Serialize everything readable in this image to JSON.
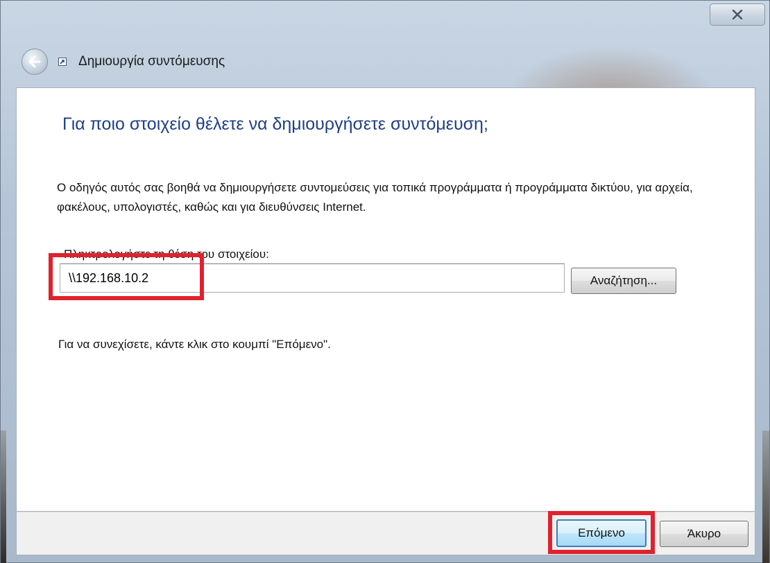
{
  "window": {
    "title": "Δημιουργία συντόμευσης",
    "close_icon": "close-icon",
    "back_icon": "back-arrow-icon",
    "title_icon": "shortcut-icon"
  },
  "content": {
    "heading": "Για ποιο στοιχείο θέλετε να δημιουργήσετε συντόμευση;",
    "description": "Ο οδηγός αυτός σας βοηθά να δημιουργήσετε συντομεύσεις για τοπικά προγράμματα ή προγράμματα δικτύου, για αρχεία, φακέλους, υπολογιστές, καθώς και για διευθύνσεις Internet.",
    "location_label": "Πληκτρολογήστε τη θέση του στοιχείου:",
    "location_value": "\\\\192.168.10.2",
    "browse_label": "Αναζήτηση...",
    "instruction": "Για να συνεχίσετε, κάντε κλικ στο κουμπί \"Επόμενο\"."
  },
  "footer": {
    "next_label": "Επόμενο",
    "cancel_label": "Άκυρο"
  },
  "colors": {
    "heading": "#1e3f8a",
    "highlight": "#e0222f",
    "default_button_border": "#3c7fb1"
  }
}
